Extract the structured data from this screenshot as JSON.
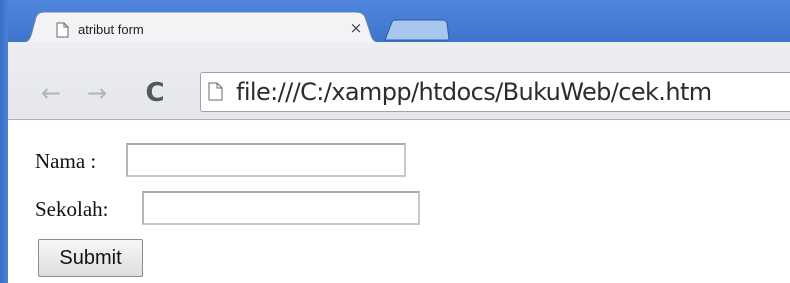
{
  "browser": {
    "tab": {
      "title": "atribut form",
      "close_glyph": "×",
      "icon": "page-icon"
    },
    "new_tab_icon": "new-tab-icon",
    "toolbar": {
      "back_glyph": "←",
      "forward_glyph": "→",
      "reload_glyph": "C",
      "url": "file:///C:/xampp/htdocs/BukuWeb/cek.htm",
      "url_icon": "page-icon"
    },
    "frame_color": "#4a80d8"
  },
  "form": {
    "nama_label": "Nama :",
    "nama_value": "",
    "sekolah_label": "Sekolah:",
    "sekolah_value": "",
    "submit_label": "Submit"
  }
}
